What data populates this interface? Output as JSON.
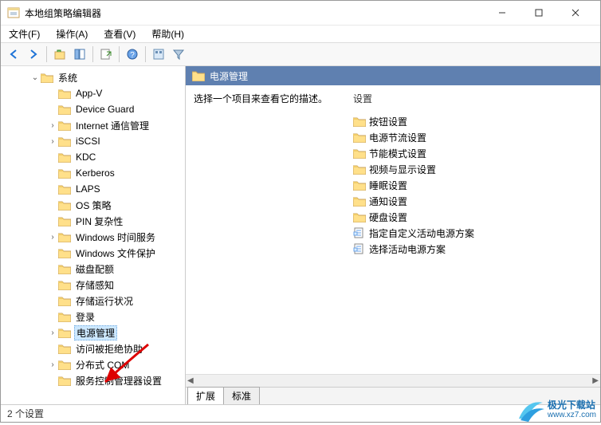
{
  "title": "本地组策略编辑器",
  "menu": {
    "file": "文件(F)",
    "action": "操作(A)",
    "view": "查看(V)",
    "help": "帮助(H)"
  },
  "tree": {
    "root": "系统",
    "items": [
      "App-V",
      "Device Guard",
      "Internet 通信管理",
      "iSCSI",
      "KDC",
      "Kerberos",
      "LAPS",
      "OS 策略",
      "PIN 复杂性",
      "Windows 时间服务",
      "Windows 文件保护",
      "磁盘配额",
      "存储感知",
      "存储运行状况",
      "登录",
      "电源管理",
      "访问被拒绝协助",
      "分布式 COM",
      "服务控制管理器设置"
    ],
    "selected_index": 15
  },
  "detail": {
    "header": "电源管理",
    "desc_prompt": "选择一个项目来查看它的描述。",
    "settings_label": "设置",
    "folders": [
      "按钮设置",
      "电源节流设置",
      "节能模式设置",
      "视频与显示设置",
      "睡眠设置",
      "通知设置",
      "硬盘设置"
    ],
    "policies": [
      "指定自定义活动电源方案",
      "选择活动电源方案"
    ]
  },
  "tabs": {
    "extended": "扩展",
    "standard": "标准"
  },
  "status": "2 个设置",
  "watermark": {
    "brand": "极光下载站",
    "url": "www.xz7.com"
  }
}
